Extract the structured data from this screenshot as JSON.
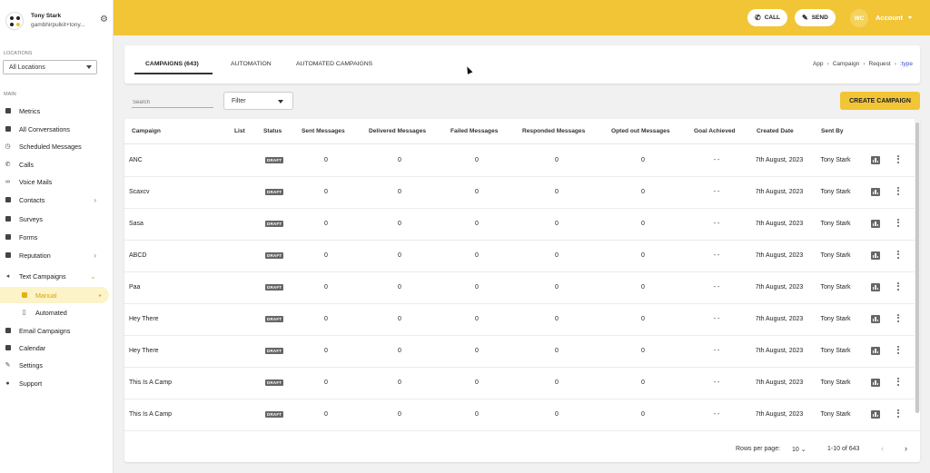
{
  "user": {
    "name": "Tony Stark",
    "email": "gambhirpulkit+tony..."
  },
  "sidebar": {
    "locations_label": "LOCATIONS",
    "location_select": "All Locations",
    "main_label": "MAIN",
    "items": [
      {
        "label": "Metrics",
        "icon": "metrics-icon"
      },
      {
        "label": "All Conversations",
        "icon": "chat-icon"
      },
      {
        "label": "Scheduled Messages",
        "icon": "clock-icon"
      },
      {
        "label": "Calls",
        "icon": "phone-icon"
      },
      {
        "label": "Voice Mails",
        "icon": "voicemail-icon"
      },
      {
        "label": "Contacts",
        "icon": "contacts-icon"
      },
      {
        "label": "Surveys",
        "icon": "survey-icon"
      },
      {
        "label": "Forms",
        "icon": "form-icon"
      },
      {
        "label": "Reputation",
        "icon": "star-icon"
      },
      {
        "label": "Text Campaigns",
        "icon": "megaphone-icon"
      },
      {
        "label": "Manual",
        "icon": "manual-icon"
      },
      {
        "label": "Automated",
        "icon": "automated-icon"
      },
      {
        "label": "Email Campaigns",
        "icon": "email-icon"
      },
      {
        "label": "Calendar",
        "icon": "calendar-icon"
      },
      {
        "label": "Settings",
        "icon": "settings-icon"
      },
      {
        "label": "Support",
        "icon": "help-icon"
      }
    ]
  },
  "topbar": {
    "call_label": "CALL",
    "send_label": "SEND",
    "avatar_initials": "WC",
    "account_label": "Account",
    "accent_color": "#f2c537"
  },
  "tabs": [
    {
      "label": "CAMPAIGNS (643)"
    },
    {
      "label": "AUTOMATION"
    },
    {
      "label": "AUTOMATED CAMPAIGNS"
    }
  ],
  "breadcrumb": [
    "App",
    "Campaign",
    "Request",
    ":type"
  ],
  "toolbar": {
    "search_placeholder": "Search",
    "filter_label": "Filter",
    "create_label": "CREATE CAMPAIGN"
  },
  "table": {
    "columns": [
      "Campaign",
      "List",
      "Status",
      "Sent Messages",
      "Delivered Messages",
      "Failed Messages",
      "Responded Messages",
      "Opted out Messages",
      "Goal Achieved",
      "Created Date",
      "Sent By"
    ],
    "rows": [
      {
        "campaign": "ANC",
        "status": "DRAFT",
        "sent": "0",
        "delivered": "0",
        "failed": "0",
        "responded": "0",
        "opted_out": "0",
        "goal": "- -",
        "created": "7th August, 2023",
        "sent_by": "Tony Stark"
      },
      {
        "campaign": "Scaxcv",
        "status": "DRAFT",
        "sent": "0",
        "delivered": "0",
        "failed": "0",
        "responded": "0",
        "opted_out": "0",
        "goal": "- -",
        "created": "7th August, 2023",
        "sent_by": "Tony Stark"
      },
      {
        "campaign": "Sasa",
        "status": "DRAFT",
        "sent": "0",
        "delivered": "0",
        "failed": "0",
        "responded": "0",
        "opted_out": "0",
        "goal": "- -",
        "created": "7th August, 2023",
        "sent_by": "Tony Stark"
      },
      {
        "campaign": "ABCD",
        "status": "DRAFT",
        "sent": "0",
        "delivered": "0",
        "failed": "0",
        "responded": "0",
        "opted_out": "0",
        "goal": "- -",
        "created": "7th August, 2023",
        "sent_by": "Tony Stark"
      },
      {
        "campaign": "Paa",
        "status": "DRAFT",
        "sent": "0",
        "delivered": "0",
        "failed": "0",
        "responded": "0",
        "opted_out": "0",
        "goal": "- -",
        "created": "7th August, 2023",
        "sent_by": "Tony Stark"
      },
      {
        "campaign": "Hey There",
        "status": "DRAFT",
        "sent": "0",
        "delivered": "0",
        "failed": "0",
        "responded": "0",
        "opted_out": "0",
        "goal": "- -",
        "created": "7th August, 2023",
        "sent_by": "Tony Stark"
      },
      {
        "campaign": "Hey There",
        "status": "DRAFT",
        "sent": "0",
        "delivered": "0",
        "failed": "0",
        "responded": "0",
        "opted_out": "0",
        "goal": "- -",
        "created": "7th August, 2023",
        "sent_by": "Tony Stark"
      },
      {
        "campaign": "This Is A Camp",
        "status": "DRAFT",
        "sent": "0",
        "delivered": "0",
        "failed": "0",
        "responded": "0",
        "opted_out": "0",
        "goal": "- -",
        "created": "7th August, 2023",
        "sent_by": "Tony Stark"
      },
      {
        "campaign": "This Is A Camp",
        "status": "DRAFT",
        "sent": "0",
        "delivered": "0",
        "failed": "0",
        "responded": "0",
        "opted_out": "0",
        "goal": "- -",
        "created": "7th August, 2023",
        "sent_by": "Tony Stark"
      }
    ]
  },
  "pagination": {
    "rows_per_page_label": "Rows per page:",
    "rows_per_page": "10",
    "range": "1-10 of 643"
  }
}
